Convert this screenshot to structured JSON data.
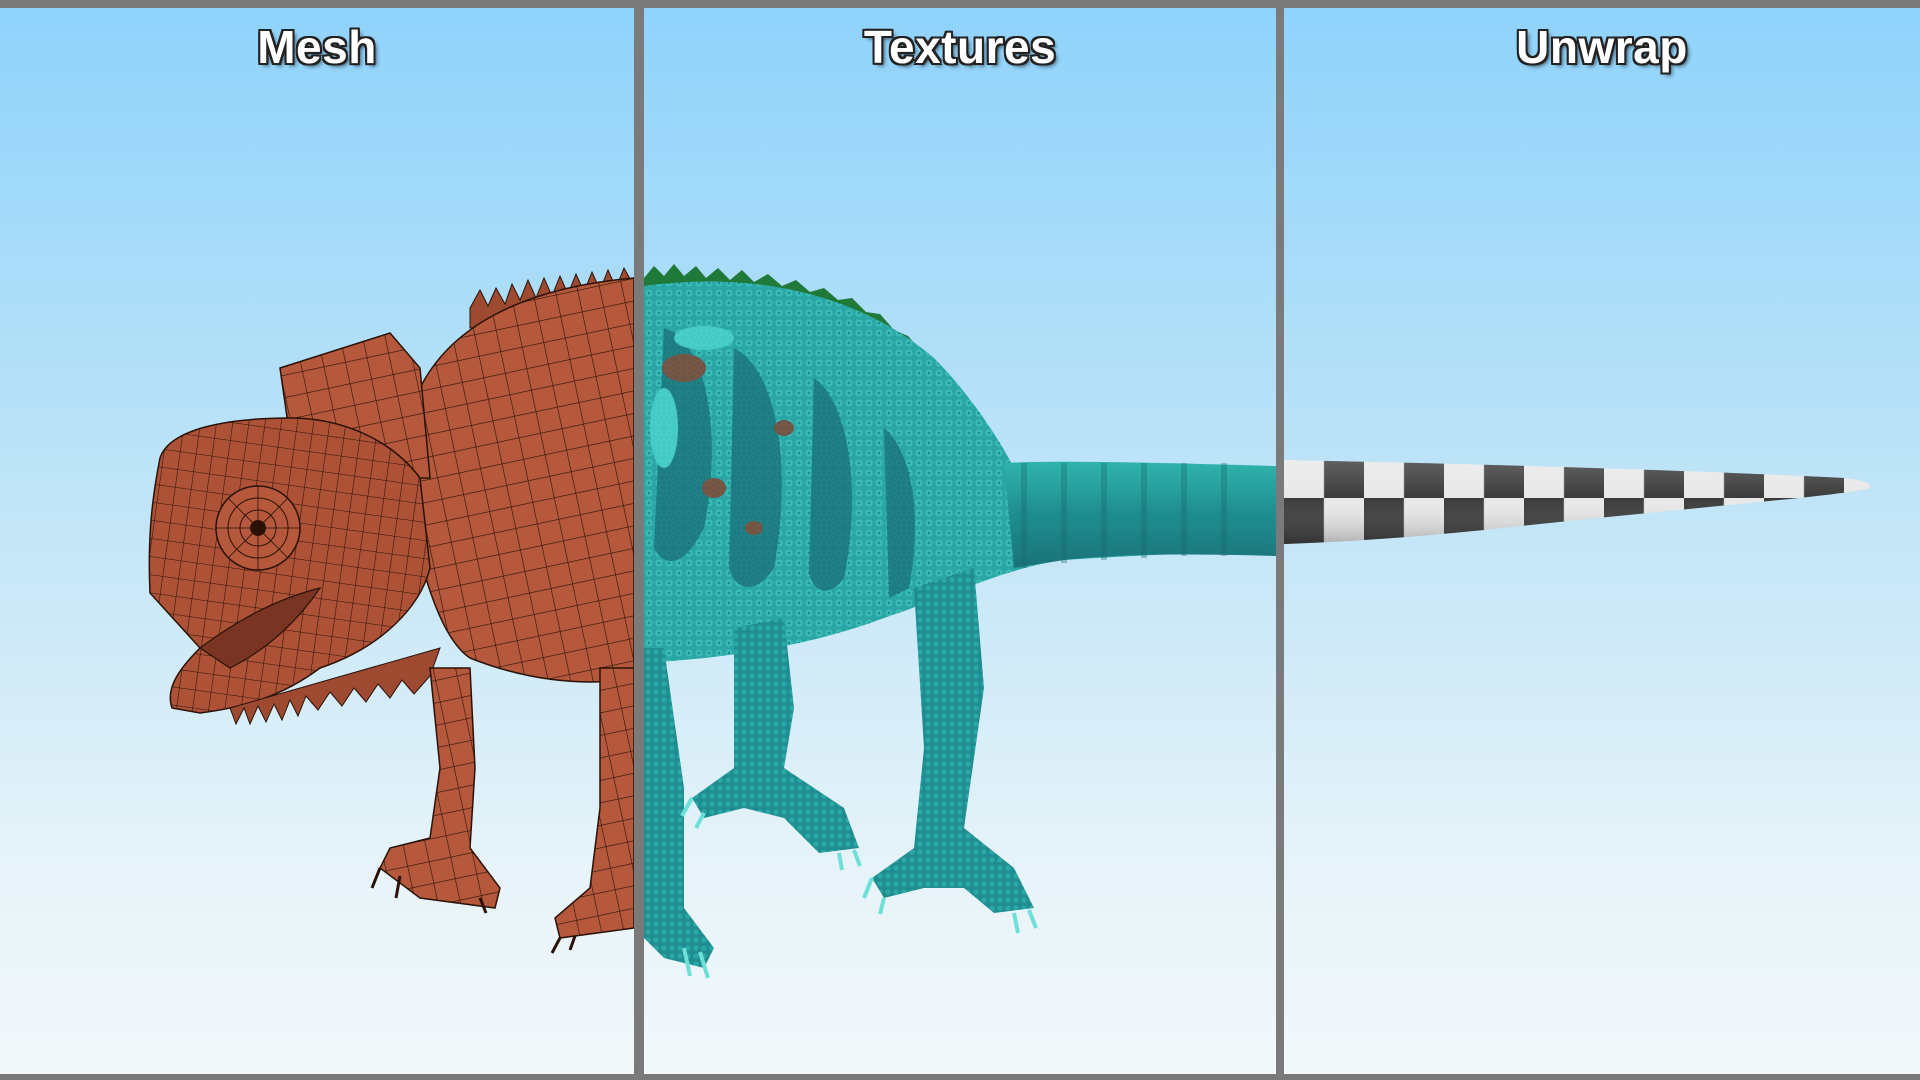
{
  "panels": [
    {
      "title": "Mesh"
    },
    {
      "title": "Textures"
    },
    {
      "title": "Unwrap"
    }
  ],
  "colors": {
    "mesh_skin": "#b5583b",
    "mesh_wire": "#2a1208",
    "texture_skin": "#2aa6a6",
    "texture_dark": "#1a6f78",
    "texture_spot": "#8a3a22",
    "checker_light": "#e8e8e8",
    "checker_dark": "#3c3c3c",
    "divider": "#7a7a7a",
    "sky_top": "#8fd3fb",
    "sky_bottom": "#f3f8fa"
  }
}
